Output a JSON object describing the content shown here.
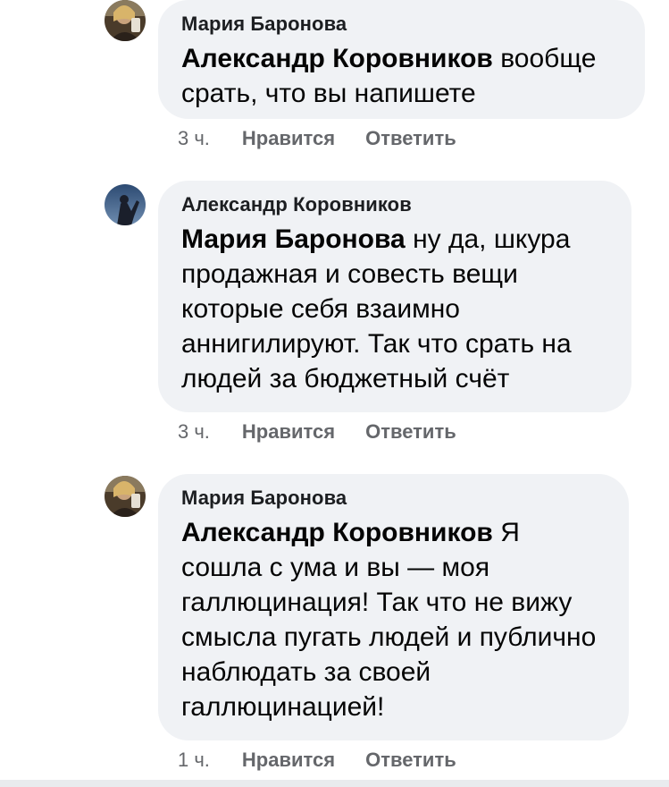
{
  "comments": [
    {
      "author": "Мария Баронова",
      "mention": "Александр Коровников",
      "text": " вообще срать, что вы напишете",
      "time": "3 ч.",
      "like_label": "Нравится",
      "reply_label": "Ответить",
      "avatar_icon": "user-photo-icon"
    },
    {
      "author": "Александр Коровников",
      "mention": "Мария Баронова",
      "text": " ну да, шкура продажная и совесть вещи которые себя взаимно аннигилируют. Так что срать на людей за бюджетный счёт",
      "time": "3 ч.",
      "like_label": "Нравится",
      "reply_label": "Ответить",
      "avatar_icon": "user-photo-icon"
    },
    {
      "author": "Мария Баронова",
      "mention": "Александр Коровников",
      "text": " Я сошла с ума и вы — моя галлюцинация! Так что не вижу смысла пугать людей и публично наблюдать за своей галлюцинацией!",
      "time": "1 ч.",
      "like_label": "Нравится",
      "reply_label": "Ответить",
      "avatar_icon": "user-photo-icon"
    }
  ],
  "colors": {
    "bubble_bg": "#f0f2f5",
    "meta_text": "#65676b",
    "body_text": "#050505"
  }
}
